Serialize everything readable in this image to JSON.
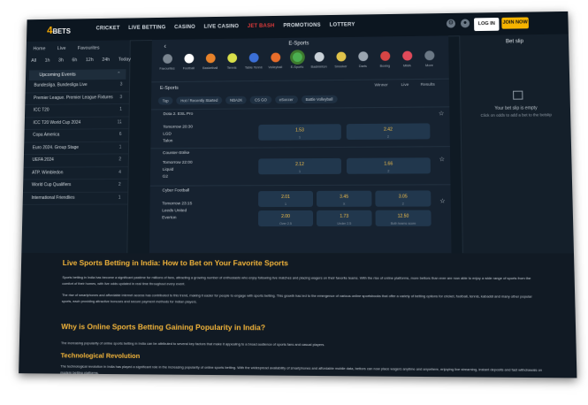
{
  "nav": {
    "logo_main": "4",
    "logo_sub": "BETS",
    "links": [
      "CRICKET",
      "LIVE BETTING",
      "CASINO",
      "LIVE CASINO",
      "JET BASH",
      "PROMOTIONS",
      "LOTTERY"
    ],
    "login": "LOG IN",
    "join": "JOIN NOW"
  },
  "sidebar": {
    "tabs": [
      "Home",
      "Live",
      "Favourites"
    ],
    "times": [
      "All",
      "1h",
      "3h",
      "6h",
      "12h",
      "24h",
      "Today"
    ],
    "section": "Upcoming Events",
    "rows": [
      {
        "label": "Bundesliga. Bundesliga Live",
        "count": "3"
      },
      {
        "label": "Premier League. Premier League Fixtures",
        "count": "3"
      },
      {
        "label": "ICC T20",
        "count": "1"
      },
      {
        "label": "ICC T20 World Cup 2024",
        "count": "11"
      },
      {
        "label": "Copa America",
        "count": "6"
      },
      {
        "label": "Euro 2024. Group Stage",
        "count": "1"
      },
      {
        "label": "UEFA 2024",
        "count": "2"
      },
      {
        "label": "ATP. Wimbledon",
        "count": "4"
      },
      {
        "label": "World Cup Qualifiers",
        "count": "2"
      },
      {
        "label": "International Friendlies",
        "count": "1"
      }
    ]
  },
  "center": {
    "title": "E-Sports",
    "sports": [
      {
        "label": "Favourites",
        "color": "#7a8590"
      },
      {
        "label": "Football",
        "color": "#ffffff"
      },
      {
        "label": "Basketball",
        "color": "#e8822a"
      },
      {
        "label": "Tennis",
        "color": "#d9e04a"
      },
      {
        "label": "Table Tennis",
        "color": "#3b6fd6"
      },
      {
        "label": "Volleyball",
        "color": "#e86d2a"
      },
      {
        "label": "E-Sports",
        "color": "#4caf50"
      },
      {
        "label": "Badminton",
        "color": "#c9d1d8"
      },
      {
        "label": "Snooker",
        "color": "#e0c34a"
      },
      {
        "label": "Darts",
        "color": "#9aa5b0"
      },
      {
        "label": "Boxing",
        "color": "#d64545"
      },
      {
        "label": "MMA",
        "color": "#e04a5a"
      },
      {
        "label": "More",
        "color": "#6b7885"
      }
    ],
    "filter_label": "E-Sports",
    "filter_opts": [
      "Winner",
      "Live",
      "Results"
    ],
    "chips": [
      "Top",
      "Hot / Recently Started",
      "NBA2K",
      "CS GO",
      "eSoccer",
      "Battle Volleyball",
      "Cyber Cricket"
    ],
    "matches": [
      {
        "league": "Dota 2. ESL Pro",
        "time": "Tomorrow 20:30",
        "teams": [
          "LGD",
          "Talon"
        ],
        "odds": [
          {
            "v": "1.53",
            "s": "1"
          },
          {
            "v": "2.42",
            "s": "2"
          }
        ]
      },
      {
        "league": "Counter-Strike",
        "time": "Tomorrow 22:00",
        "teams": [
          "Liquid",
          "G2"
        ],
        "odds": [
          {
            "v": "2.12",
            "s": "1"
          },
          {
            "v": "1.66",
            "s": "2"
          }
        ]
      },
      {
        "league": "Cyber Football",
        "time": "Tomorrow 23:15",
        "teams": [
          "Leeds United",
          "Everton"
        ],
        "odds3": [
          {
            "v": "2.01",
            "s": "1"
          },
          {
            "v": "3.45",
            "s": "X"
          },
          {
            "v": "3.05",
            "s": "2"
          },
          {
            "v": "2.00",
            "s": "Over 2.5"
          },
          {
            "v": "1.73",
            "s": "Under 2.5"
          },
          {
            "v": "12.50",
            "s": "Both teams score"
          }
        ]
      }
    ]
  },
  "betslip": {
    "title": "Bet slip",
    "empty_title": "Your bet slip is empty",
    "empty_hint": "Click on odds to add a bet to the betslip"
  },
  "article": {
    "h1": "Live Sports Betting in India: How to Bet on Your Favorite Sports",
    "p1": "Sports betting in India has become a significant pastime for millions of fans, attracting a growing number of enthusiasts who enjoy following live matches and placing wagers on their favorite teams. With the rise of online platforms, more bettors than ever are now able to enjoy a wide range of sports from the comfort of their homes, with live odds updated in real time throughout every event.",
    "p2": "The rise of smartphones and affordable internet access has contributed to this trend, making it easier for people to engage with sports betting. This growth has led to the emergence of various online sportsbooks that offer a variety of betting options for cricket, football, tennis, kabaddi and many other popular sports, each providing attractive bonuses and secure payment methods for Indian players.",
    "h2": "Why is Online Sports Betting Gaining Popularity in India?",
    "p3": "The increasing popularity of online sports betting in India can be attributed to several key factors that make it appealing to a broad audience of sports fans and casual players.",
    "h3": "Technological Revolution",
    "p4": "The technological revolution in India has played a significant role in the increasing popularity of online sports betting. With the widespread availability of smartphones and affordable mobile data, bettors can now place wagers anytime and anywhere, enjoying live streaming, instant deposits and fast withdrawals on modern betting platforms."
  }
}
